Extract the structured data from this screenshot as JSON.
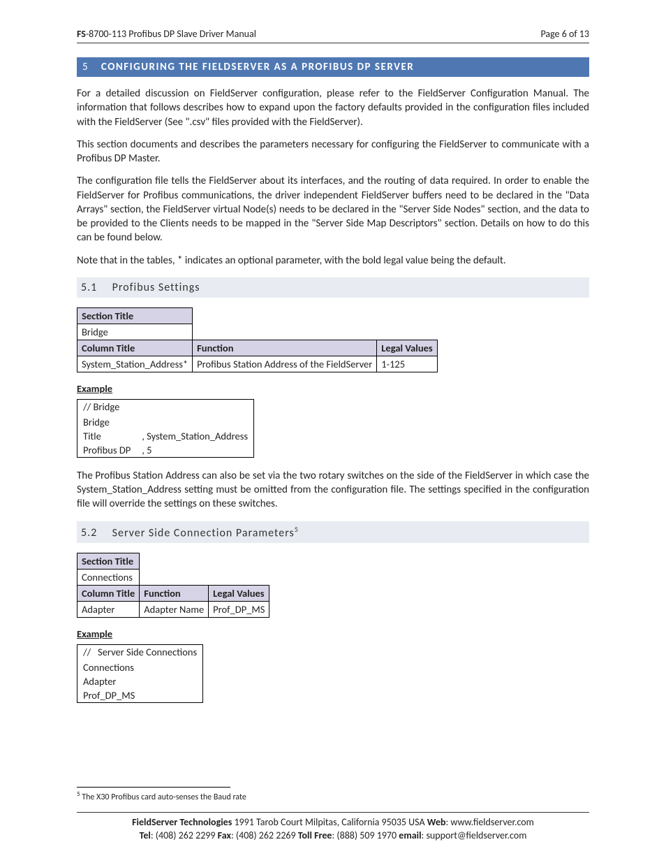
{
  "header": {
    "left_bold": "FS",
    "left_rest": "-8700-113 Profibus DP Slave Driver Manual",
    "right": "Page 6 of 13"
  },
  "section": {
    "number": "5",
    "title": "CONFIGURING THE FIELDSERVER AS A PROFIBUS DP SERVER"
  },
  "paragraphs": {
    "p1": "For a detailed discussion on FieldServer configuration, please refer to the FieldServer Configuration Manual.  The information that follows describes how to expand upon the factory defaults provided in the configuration files included with the FieldServer (See \".csv\" files provided with the FieldServer).",
    "p2": "This section documents and describes the parameters necessary for configuring the FieldServer to communicate with a Profibus DP Master.",
    "p3": "The configuration file tells the FieldServer about its interfaces, and the routing of data required. In order to enable the FieldServer for Profibus communications, the driver independent FieldServer buffers need to be declared in the \"Data Arrays\" section, the FieldServer virtual Node(s) needs to be declared in the \"Server Side Nodes\" section, and the data to be provided to the Clients needs to be mapped in the \"Server Side Map Descriptors\" section. Details on how to do this can be found below.",
    "p4": "Note that in the tables, * indicates an optional parameter, with the bold legal value being the default."
  },
  "sub1": {
    "number": "5.1",
    "title": "Profibus Settings"
  },
  "table1": {
    "section_title_label": "Section Title",
    "section_title_value": "Bridge",
    "col_label": "Column Title",
    "func_label": "Function",
    "legal_label": "Legal Values",
    "row1": {
      "col": "System_Station_Address*",
      "func": "Profibus Station Address of the FieldServer",
      "legal": "1-125"
    }
  },
  "example_label": "Example",
  "example1": {
    "l1": "// Bridge",
    "l2": "",
    "l3a": "Bridge",
    "l4a": "Title",
    "l4b": ", System_Station_Address",
    "l5a": "Profibus DP",
    "l5b": ", 5"
  },
  "para_after_ex1": "The Profibus Station Address can also be set via the two rotary switches on the side of the FieldServer in which case the System_Station_Address setting must be omitted from the configuration file.  The settings specified in the configuration file will override the settings on these switches.",
  "sub2": {
    "number": "5.2",
    "title": "Server Side Connection Parameters",
    "fn": "5"
  },
  "table2": {
    "section_title_label": "Section Title",
    "section_title_value": "Connections",
    "col_label": "Column Title",
    "func_label": "Function",
    "legal_label": "Legal Values",
    "row1": {
      "col": "Adapter",
      "func": "Adapter Name",
      "legal": "Prof_DP_MS"
    }
  },
  "example2": {
    "l1": "//   Server Side Connections",
    "l2": "",
    "l3": "Connections",
    "l4": "Adapter",
    "l5": "Prof_DP_MS"
  },
  "footnote": {
    "num": "5",
    "text": " The X30 Profibus card auto-senses the Baud rate"
  },
  "footer": {
    "line1_b1": "FieldServer Technologies",
    "line1_rest": " 1991 Tarob Court Milpitas, California 95035 USA   ",
    "line1_b2": "Web",
    "line1_web": ": www.fieldserver.com",
    "line2_b1": "Tel",
    "line2_tel": ": (408) 262 2299   ",
    "line2_b2": "Fax",
    "line2_fax": ": (408) 262 2269   ",
    "line2_b3": "Toll Free",
    "line2_toll": ": (888) 509 1970   ",
    "line2_b4": "email",
    "line2_email": ": support@fieldserver.com"
  }
}
